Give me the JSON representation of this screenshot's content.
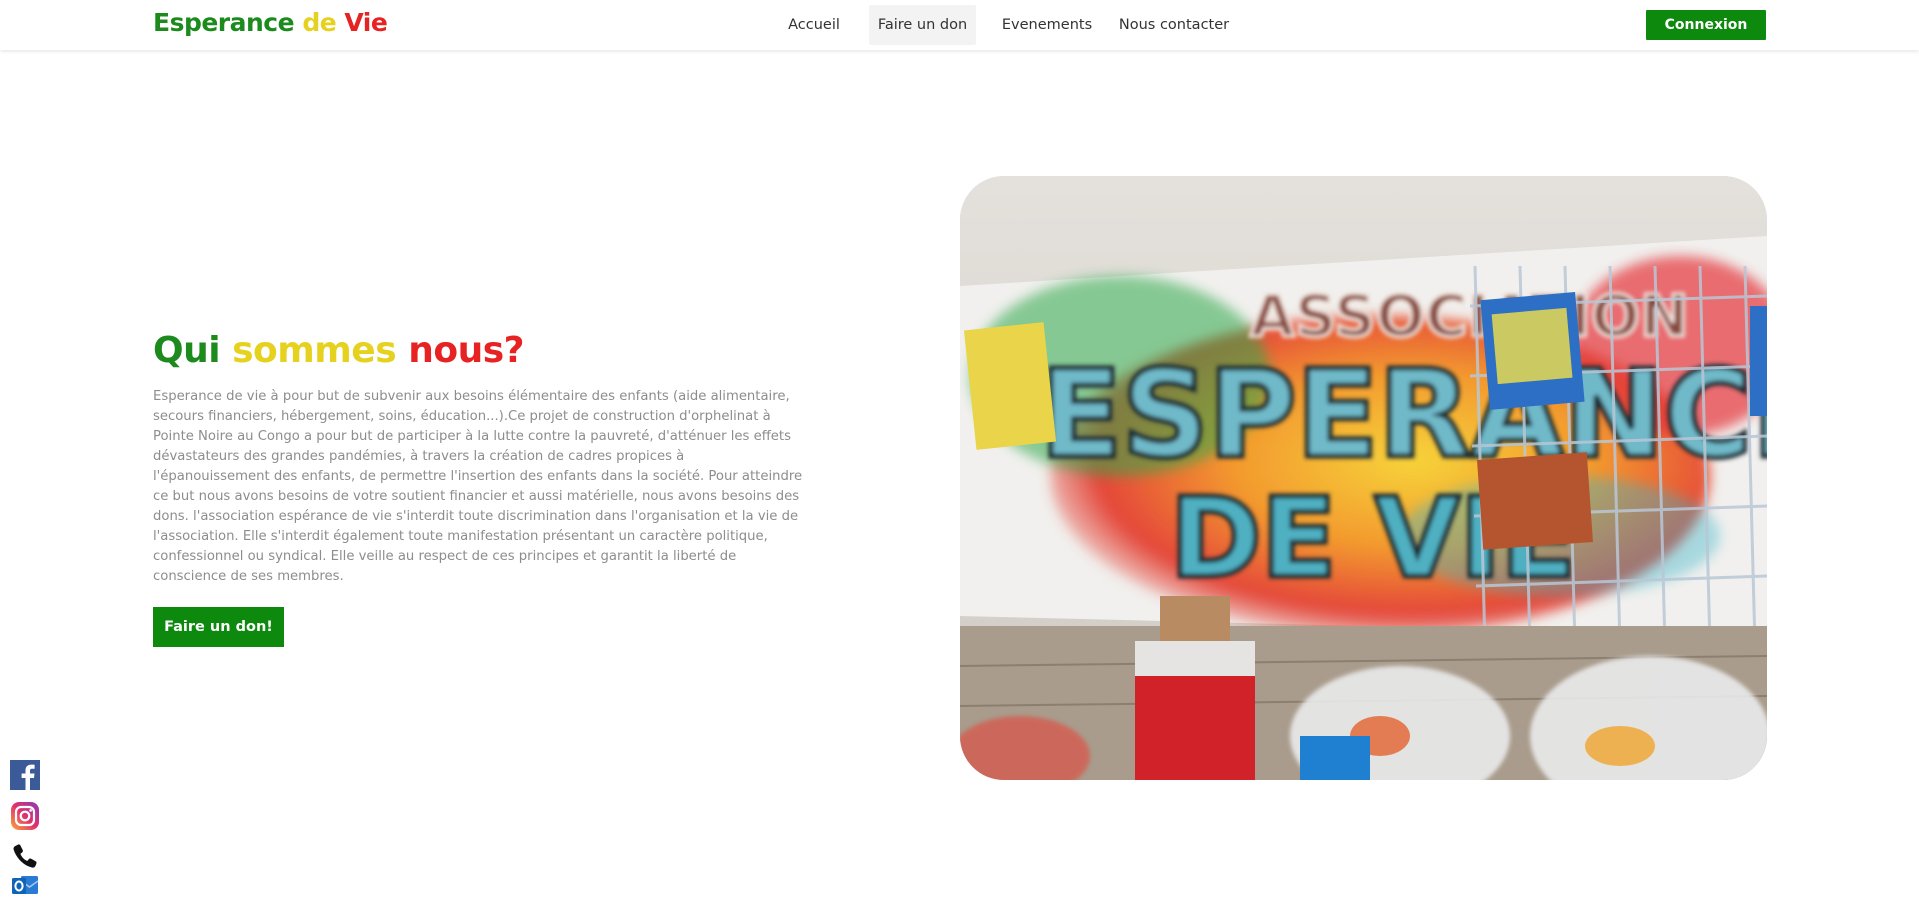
{
  "brand": {
    "logo_parts": [
      "Esperance",
      "de",
      "Vie"
    ],
    "colors": {
      "green": "#1c8a1c",
      "yellow": "#e6d21e",
      "red": "#e62222",
      "button_green": "#0d8a0d"
    }
  },
  "nav": {
    "items": [
      {
        "label": "Accueil",
        "active": false
      },
      {
        "label": "Faire un don",
        "active": true
      },
      {
        "label": "Evenements",
        "active": false
      },
      {
        "label": "Nous contacter",
        "active": false
      }
    ],
    "login_label": "Connexion"
  },
  "hero": {
    "title_parts": [
      "Qui",
      "sommes",
      "nous?"
    ],
    "description": "Esperance de vie à pour but de subvenir aux besoins élémentaire des enfants (aide alimentaire, secours financiers, hébergement, soins, éducation...).Ce projet de construction d'orphelinat à Pointe Noire au Congo a pour but de participer à la lutte contre la pauvreté, d'atténuer les effets dévastateurs des grandes pandémies, à travers la création de cadres propices à l'épanouissement des enfants, de permettre l'insertion des enfants dans la société. Pour atteindre ce but nous avons besoins de votre soutient financier et aussi matérielle, nous avons besoins des dons. l'association espérance de vie s'interdit toute discrimination dans l'organisation et la vie de l'association. Elle s'interdit également toute manifestation présentant un caractère politique, confessionnel ou syndical. Elle veille au respect de ces principes et garantit la liberté de conscience de ses membres.",
    "donate_label": "Faire un don!"
  },
  "photo": {
    "banner_lines": [
      "ASSOCIATION",
      "ESPERANCE",
      "DE VIE"
    ]
  },
  "social": {
    "icons": [
      "facebook-icon",
      "instagram-icon",
      "phone-icon",
      "outlook-icon"
    ]
  }
}
